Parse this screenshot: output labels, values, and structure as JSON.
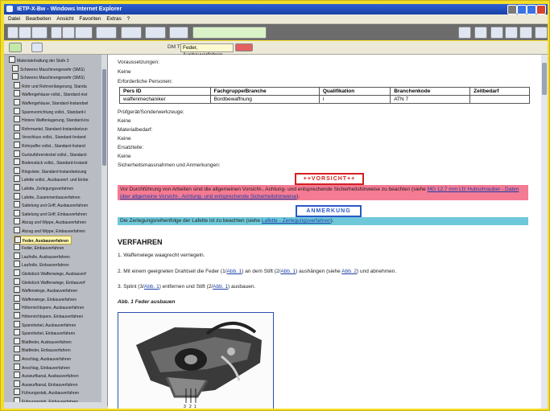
{
  "window": {
    "title": "IETP-X-Bw - Windows Internet Explorer"
  },
  "menu": [
    "Datei",
    "Bearbeiten",
    "Ansicht",
    "Favoriten",
    "Extras",
    "?"
  ],
  "subbar": {
    "dm_label": "DM Titel:",
    "dm_value": "Feder, Ausbauverfahren"
  },
  "sidebar": {
    "items": [
      "Materialerhaltung der Stufe 3",
      "Schweres Maschinengewehr (SMG)",
      "Schweres Maschinengewehr (SMG)",
      "Rohr und Rohrverlängerung, Standa",
      "Waffengehäuse vollst., Standard-inst",
      "Waffengehäuse, Standard-Instandset",
      "Spannvorrichtung vollst., Standard-I",
      "Hintere Waffenlagerung, Standard-ins",
      "Rohrmantel, Standard-Instandsetzun",
      "Verschluss vollst., Standard-Instand",
      "Rohrpuffer vollst., Standard-Instand",
      "Gurtzuführerdeckel vollst., Standard-",
      "Bodenstück vollst., Standard-Instand",
      "Ringvisier, Standard-Instandsetzung",
      "Lafette vollst., Ausbauverf. und Einbe",
      "Lafette, Zerlegungsverfahren",
      "Lafette, Zusammenbauverfahren",
      "Sattelung und Griff, Ausbauverfahren",
      "Sattelung und Griff, Einbauverfahren",
      "Abzug und Wippe, Ausbauverfahren",
      "Abzug und Wippe, Einbauverfahren",
      "Feder, Ausbauverfahren",
      "Feder, Einbauverfahren",
      "Laufrolle, Ausbauverfahren",
      "Laufrolle, Einbauverfahren",
      "Gleitstück Waffenwiege, Ausbauverf",
      "Gleitstück Waffenwiege, Einbauverf",
      "Waffenwiege, Ausbauverfahren",
      "Waffenwiege, Einbauverfahren",
      "Höhenrichtspere, Ausbauverfahren",
      "Höhenrichtspere, Einbauverfahren",
      "Spannhebel, Ausbauverfahren",
      "Spannhebel, Einbauverfahren",
      "Blattfeder, Ausbauverfahren",
      "Blattfeder, Einbauverfahren",
      "Anschlag, Ausbauverfahren",
      "Anschlag, Einbauverfahren",
      "Auswurfkanal, Ausbauverfahren",
      "Auswurfkanal, Einbauverfahren",
      "Führungsstab, Ausbauverfahren",
      "Führungsstab, Einbauverfahren"
    ],
    "selected_index": 21
  },
  "content": {
    "voraussetzungen": "Voraussetzungen:",
    "keine1": "Keine",
    "personen": "Erforderliche Personen:",
    "table": {
      "headers": [
        "Pers ID",
        "Fachgruppe/Branche",
        "Qualifikation",
        "Branchenkode",
        "Zeitbedarf"
      ],
      "row": [
        "waffenmechaniker",
        "Bordbewaffnung",
        "i",
        "ATN 7",
        ""
      ]
    },
    "pruefgeraet": "Prüfgerät/Sonderwerkzeuge:",
    "keine2": "Keine",
    "materialbedarf": "Materialbedarf:",
    "keine3": "Keine",
    "ersatzteile": "Ersatzteile:",
    "keine4": "Keine",
    "sicherheit": "Sicherheitsmassnahmen und Anmerkungen:",
    "vorsicht": "++VORSICHT++",
    "warning_text": "Vor Durchführung von Arbeiten sind die allgemeinen Vorsicht-, Achtung- und entsprechende Sicherheitshinweise zu beachten (siehe",
    "warning_link": "MG 12,7 mm Lfz Hubschrauber - Daten über allgemeine Vorsicht-, Achtung- und entsprechende Sicherheitshinweise",
    "anmerkung": "ANMERKUNG",
    "note_text": "Die Zerlegungsreihenfolge der Lafette ist zu beachten (siehe",
    "note_link": "Lafette - Zerlegungsverfahren",
    "verfahren": "VERFAHREN",
    "step1": "1.  Waffenwiege waagrecht verriegeln.",
    "step2_a": "2.  Mit einem geeigneten Drahtseil die Feder (1/",
    "step2_b": ") an dem Stift (2/",
    "step2_c": ") aushängen (siehe",
    "step2_d": ") und abnehmen.",
    "step3_a": "3.  Splint (3/",
    "step3_b": ") entfernen und Stift (2/",
    "step3_c": ") ausbauen.",
    "abb1": "Abb. 1",
    "abb2": "Abb. 2",
    "abb_title": "Abb. 1 Feder ausbauen",
    "figure_labels": [
      "3",
      "2",
      "1"
    ]
  }
}
